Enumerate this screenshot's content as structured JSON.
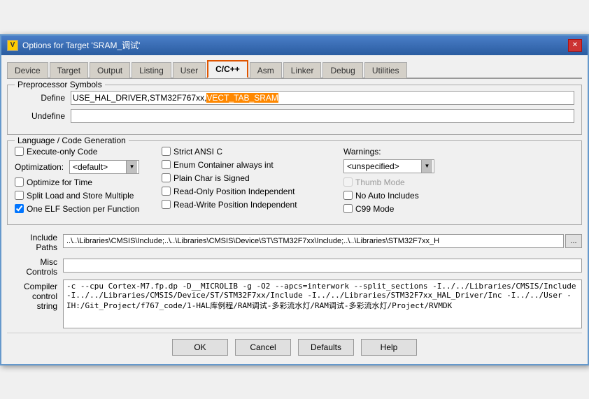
{
  "window": {
    "title": "Options for Target 'SRAM_调试'",
    "icon": "V",
    "close_btn": "✕"
  },
  "tabs": [
    {
      "label": "Device",
      "active": false
    },
    {
      "label": "Target",
      "active": false
    },
    {
      "label": "Output",
      "active": false
    },
    {
      "label": "Listing",
      "active": false
    },
    {
      "label": "User",
      "active": false
    },
    {
      "label": "C/C++",
      "active": true
    },
    {
      "label": "Asm",
      "active": false
    },
    {
      "label": "Linker",
      "active": false
    },
    {
      "label": "Debug",
      "active": false
    },
    {
      "label": "Utilities",
      "active": false
    }
  ],
  "preprocessor": {
    "title": "Preprocessor Symbols",
    "define_label": "Define",
    "define_value_prefix": "USE_HAL_DRIVER,STM32F767xx,",
    "define_value_highlight": "VECT_TAB_SRAM",
    "undefine_label": "Undefine",
    "undefine_value": ""
  },
  "language": {
    "title": "Language / Code Generation",
    "col1": {
      "execute_only_code": {
        "label": "Execute-only Code",
        "checked": false
      },
      "optimization_label": "Optimization:",
      "optimization_value": "<default>",
      "optimize_for_time": {
        "label": "Optimize for Time",
        "checked": false
      },
      "split_load_store": {
        "label": "Split Load and Store Multiple",
        "checked": false
      },
      "one_elf_section": {
        "label": "One ELF Section per Function",
        "checked": true
      }
    },
    "col2": {
      "strict_ansi_c": {
        "label": "Strict ANSI C",
        "checked": false
      },
      "enum_container": {
        "label": "Enum Container always int",
        "checked": false
      },
      "plain_char_signed": {
        "label": "Plain Char is Signed",
        "checked": false
      },
      "read_only_position": {
        "label": "Read-Only Position Independent",
        "checked": false
      },
      "read_write_position": {
        "label": "Read-Write Position Independent",
        "checked": false
      }
    },
    "col3": {
      "warnings_label": "Warnings:",
      "warnings_value": "<unspecified>",
      "thumb_mode": {
        "label": "Thumb Mode",
        "checked": false,
        "disabled": true
      },
      "no_auto_includes": {
        "label": "No Auto Includes",
        "checked": false
      },
      "c99_mode": {
        "label": "C99 Mode",
        "checked": false
      }
    }
  },
  "include_paths": {
    "label": "Include\nPaths",
    "value": "..\\..\\Libraries\\CMSIS\\Include;..\\..\\Libraries\\CMSIS\\Device\\ST\\STM32F7xx\\Include;..\\..\\Libraries\\STM32F7xx_H",
    "browse": "..."
  },
  "misc_controls": {
    "label": "Misc\nControls",
    "value": ""
  },
  "compiler_control": {
    "label": "Compiler\ncontrol\nstring",
    "value": "-c --cpu Cortex-M7.fp.dp -D__MICROLIB -g -O2 --apcs=interwork --split_sections -I../../Libraries/CMSIS/Include -I../../Libraries/CMSIS/Device/ST/STM32F7xx/Include -I../../Libraries/STM32F7xx_HAL_Driver/Inc -I../../User -IH:/Git_Project/f767_code/1-HAL库例程/RAM调试-多彩流水灯/RAM调试-多彩流水灯/Project/RVMDK"
  },
  "buttons": {
    "ok": "OK",
    "cancel": "Cancel",
    "defaults": "Defaults",
    "help": "Help"
  }
}
